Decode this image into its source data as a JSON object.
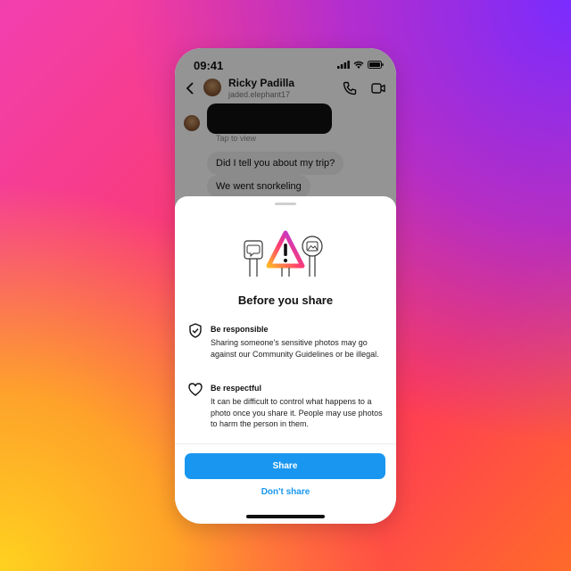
{
  "status_bar": {
    "time": "09:41",
    "icons": [
      "signal-icon",
      "wifi-icon",
      "battery-icon"
    ]
  },
  "header": {
    "contact_name": "Ricky Padilla",
    "contact_handle": "jaded.elephant17",
    "icons": [
      "back-icon",
      "call-icon",
      "video-icon"
    ]
  },
  "chat": {
    "tap_to_view": "Tap to view",
    "messages": [
      "Did I tell you about my trip?",
      "We went snorkeling"
    ]
  },
  "sheet": {
    "title": "Before you share",
    "items": [
      {
        "icon": "shield-check-icon",
        "title": "Be responsible",
        "body": "Sharing someone's sensitive photos may go against our Community Guidelines or be illegal."
      },
      {
        "icon": "heart-icon",
        "title": "Be respectful",
        "body": "It can be difficult to control what happens to a photo once you share it. People may use photos to harm the person in them."
      }
    ],
    "share_label": "Share",
    "dont_share_label": "Don't share"
  },
  "colors": {
    "accent": "#1997f0",
    "gradient": [
      "#ffd21f",
      "#ff6a2a",
      "#f23fb0",
      "#7a2cff"
    ]
  }
}
